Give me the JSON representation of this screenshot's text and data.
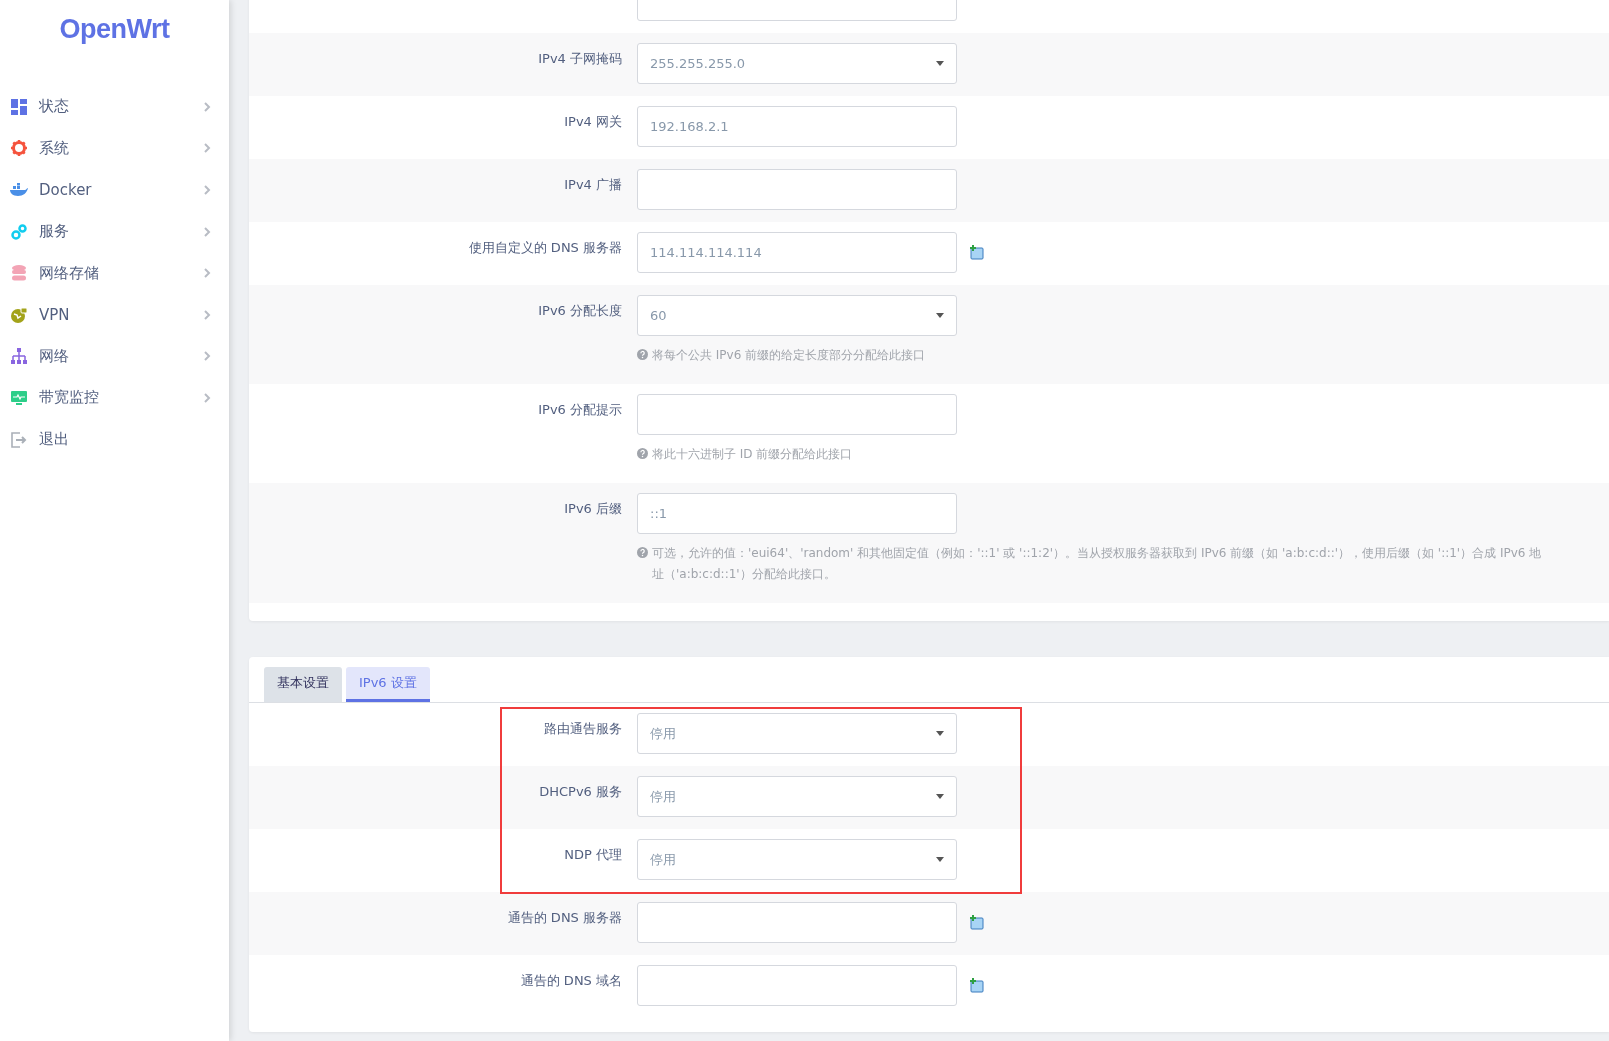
{
  "logo": "OpenWrt",
  "sidebar": {
    "items": [
      {
        "label": "状态",
        "has_submenu": true
      },
      {
        "label": "系统",
        "has_submenu": true
      },
      {
        "label": "Docker",
        "has_submenu": true
      },
      {
        "label": "服务",
        "has_submenu": true
      },
      {
        "label": "网络存储",
        "has_submenu": true
      },
      {
        "label": "VPN",
        "has_submenu": true
      },
      {
        "label": "网络",
        "has_submenu": true
      },
      {
        "label": "带宽监控",
        "has_submenu": true
      },
      {
        "label": "退出",
        "has_submenu": false
      }
    ]
  },
  "general_section": {
    "rows": [
      {
        "kind": "text"
      },
      {
        "kind": "select",
        "label": "IPv4 子网掩码",
        "value": "255.255.255.0"
      },
      {
        "kind": "text",
        "label": "IPv4 网关",
        "value": "192.168.2.1"
      },
      {
        "kind": "text",
        "label": "IPv4 广播"
      },
      {
        "kind": "text",
        "label": "使用自定义的 DNS 服务器",
        "value": "114.114.114.114",
        "add_button": true
      },
      {
        "kind": "select",
        "label": "IPv6 分配长度",
        "value": "60",
        "help": "将每个公共 IPv6 前缀的给定长度部分分配给此接口"
      },
      {
        "kind": "text",
        "label": "IPv6 分配提示",
        "help": "将此十六进制子 ID 前缀分配给此接口"
      },
      {
        "kind": "text",
        "label": "IPv6 后缀",
        "value": "::1",
        "help": "可选，允许的值：'eui64'、'random' 和其他固定值（例如：'::1' 或 '::1:2'）。当从授权服务器获取到 IPv6 前缀（如 'a:b:c:d::'），使用后缀（如 '::1'）合成 IPv6 地址（'a:b:c:d::1'）分配给此接口。"
      }
    ]
  },
  "dhcp_section": {
    "tabs": [
      {
        "label": "基本设置",
        "selected": false
      },
      {
        "label": "IPv6 设置",
        "selected": true
      }
    ],
    "rows": [
      {
        "kind": "select",
        "label": "路由通告服务",
        "value": "停用",
        "highlighted": true
      },
      {
        "kind": "select",
        "label": "DHCPv6 服务",
        "value": "停用",
        "highlighted": true
      },
      {
        "kind": "select",
        "label": "NDP 代理",
        "value": "停用",
        "highlighted": true
      },
      {
        "kind": "text",
        "label": "通告的 DNS 服务器",
        "add_button": true,
        "highlighted": false
      },
      {
        "kind": "text",
        "label": "通告的 DNS 域名",
        "add_button": true,
        "highlighted": false
      }
    ]
  }
}
